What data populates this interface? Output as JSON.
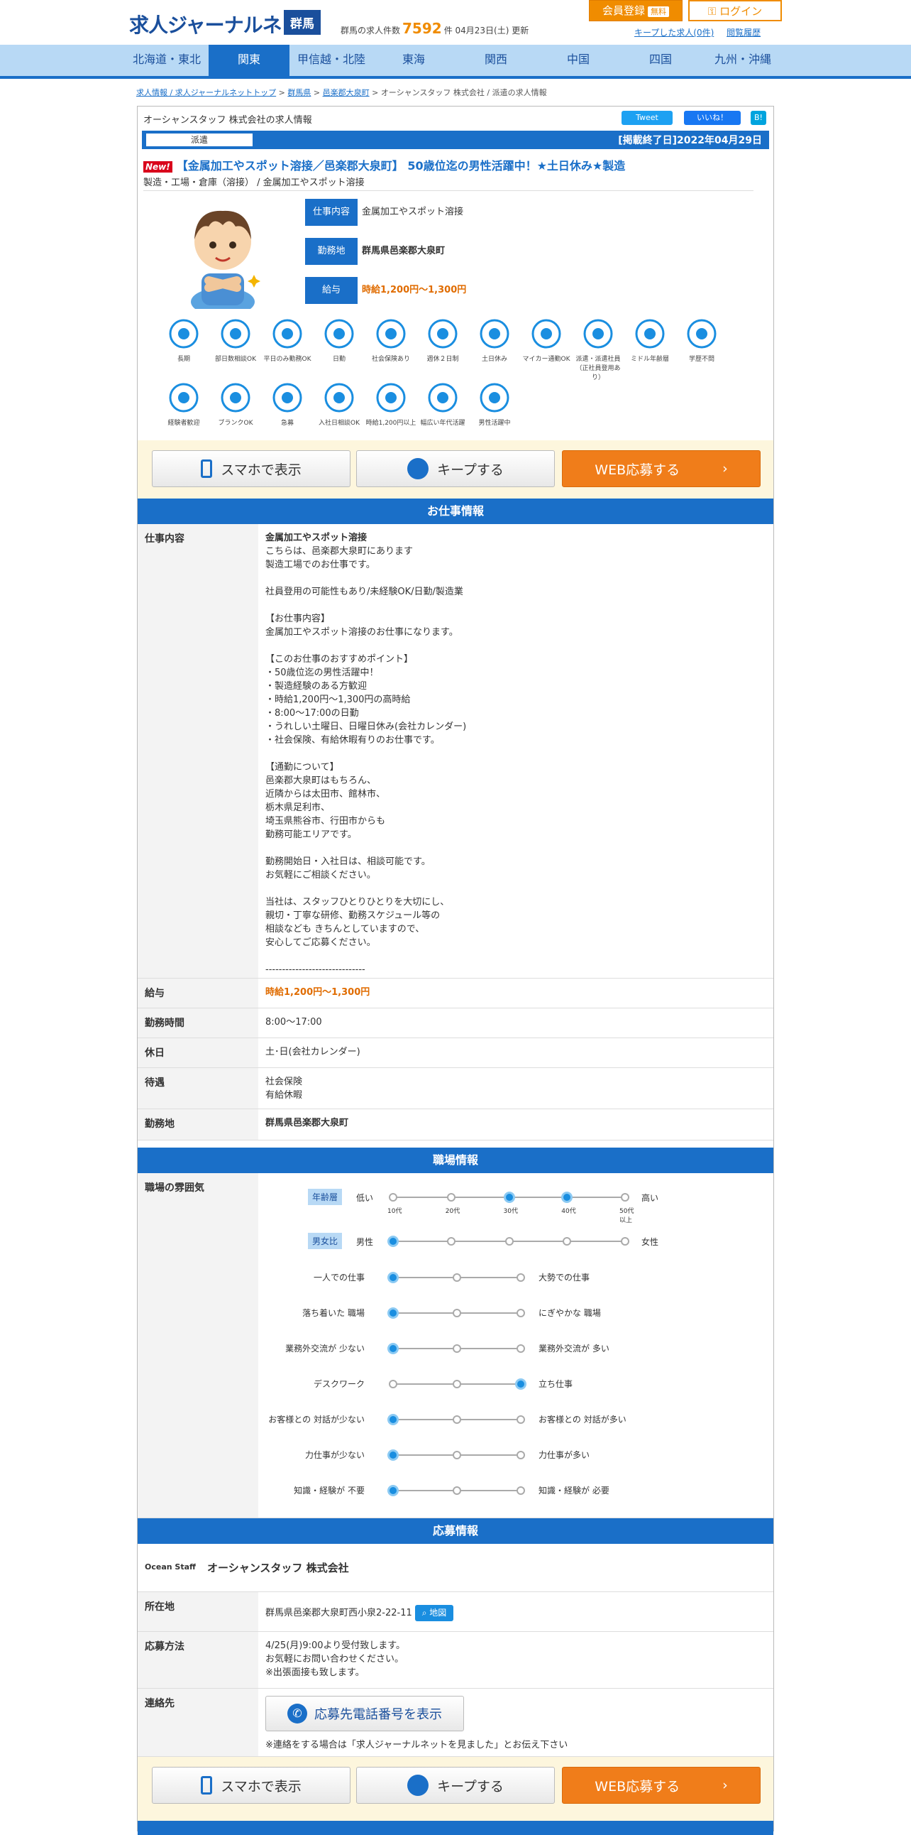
{
  "header": {
    "logo": "求人ジャーナルネット",
    "pref": "群馬",
    "count_pre": "群馬の求人件数",
    "count": "7592",
    "count_post": "件 04月23日(土) 更新",
    "register": "会員登録",
    "free": "無料",
    "login": "ログイン",
    "kept": "キープした求人(0件)",
    "history": "閲覧履歴"
  },
  "nav": [
    "北海道・東北",
    "関東",
    "甲信越・北陸",
    "東海",
    "関西",
    "中国",
    "四国",
    "九州・沖縄"
  ],
  "breadcrumb": {
    "b1": "求人情報 / 求人ジャーナルネットトップ",
    "b2": "群馬県",
    "b3": "邑楽郡大泉町",
    "b4": "オーシャンスタッフ 株式会社 / 派遣の求人情報"
  },
  "job": {
    "company_title": "オーシャンスタッフ 株式会社の求人情報",
    "tweet": "Tweet",
    "like": "いいね！",
    "hatena": "B!",
    "type": "派遣",
    "posted": "[掲載終了日]2022年04月29日",
    "new": "New!",
    "title": "【金属加工やスポット溶接／邑楽郡大泉町】 50歳位迄の男性活躍中！★土日休み★製造",
    "category": "製造・工場・倉庫（溶接） / 金属加工やスポット溶接",
    "summary": [
      {
        "label": "仕事内容",
        "value": "金属加工やスポット溶接"
      },
      {
        "label": "勤務地",
        "value": "群馬県邑楽郡大泉町"
      },
      {
        "label": "給与",
        "value": "時給1,200円～1,300円"
      }
    ]
  },
  "features": [
    "長期",
    "部日数相談OK",
    "平日のみ勤務OK",
    "日勤",
    "社会保険あり",
    "週休２日制",
    "土日休み",
    "マイカー通勤OK",
    "派遣・派遣社員（正社員登用あり）",
    "ミドル年齢層",
    "学歴不問",
    "経験者歓迎",
    "ブランクOK",
    "急募",
    "入社日相談OK",
    "時給1,200円以上",
    "幅広い年代活躍",
    "男性活躍中"
  ],
  "actions": {
    "phone": "スマホで表示",
    "keep": "キープする",
    "web": "WEB応募する"
  },
  "sections": {
    "work": "お仕事情報",
    "workplace": "職場情報",
    "apply": "応募情報"
  },
  "work_rows": [
    {
      "label": "仕事内容",
      "value_head": "金属加工やスポット溶接",
      "value": "こちらは、邑楽郡大泉町にあります\n製造工場でのお仕事です。\n\n社員登用の可能性もあり/未経験OK/日勤/製造業\n\n【お仕事内容】\n金属加工やスポット溶接のお仕事になります。\n\n【このお仕事のおすすめポイント】\n・50歳位迄の男性活躍中！\n・製造経験のある方歓迎\n・時給1,200円～1,300円の高時給\n・8:00～17:00の日勤\n・うれしい土曜日、日曜日休み(会社カレンダー)\n・社会保険、有給休暇有りのお仕事です。\n\n【通勤について】\n邑楽郡大泉町はもちろん、\n近隣からは太田市、館林市、\n栃木県足利市、\n埼玉県熊谷市、行田市からも\n勤務可能エリアです。\n\n勤務開始日・入社日は、相談可能です。\nお気軽にご相談ください。\n\n当社は、スタッフひとりひとりを大切にし、\n親切・丁寧な研修、勤務スケジュール等の\n相談なども きちんとしていますので、\n安心してご応募ください。\n\n------------------------------"
    },
    {
      "label": "給与",
      "value": "時給1,200円～1,300円"
    },
    {
      "label": "勤務時間",
      "value": "8:00～17:00"
    },
    {
      "label": "休日",
      "value": "土･日(会社カレンダー)"
    },
    {
      "label": "待遇",
      "value": "社会保険\n有給休暇"
    },
    {
      "label": "勤務地",
      "value": "群馬県邑楽郡大泉町"
    }
  ],
  "workplace": {
    "label": "職場の雰囲気",
    "age_badge": "年齢層",
    "age_low": "低い",
    "age_high": "高い",
    "ages": [
      "10代",
      "20代",
      "30代",
      "40代",
      "50代 以上"
    ],
    "gender_badge": "男女比",
    "male": "男性",
    "female": "女性",
    "scales": [
      {
        "left": "一人での仕事",
        "right": "大勢での仕事",
        "pos": 0
      },
      {
        "left": "落ち着いた 職場",
        "right": "にぎやかな 職場",
        "pos": 0
      },
      {
        "left": "業務外交流が 少ない",
        "right": "業務外交流が 多い",
        "pos": 0
      },
      {
        "left": "デスクワーク",
        "right": "立ち仕事",
        "pos": 2
      },
      {
        "left": "お客様との 対話が少ない",
        "right": "お客様との 対話が多い",
        "pos": 0
      },
      {
        "left": "力仕事が少ない",
        "right": "力仕事が多い",
        "pos": 0
      },
      {
        "left": "知識・経験が 不要",
        "right": "知識・経験が 必要",
        "pos": 0
      }
    ]
  },
  "apply": {
    "logo": "Ocean Staff",
    "company": "オーシャンスタッフ 株式会社",
    "addr_label": "所在地",
    "addr": "群馬県邑楽郡大泉町西小泉2-22-11",
    "map": "地図",
    "method_label": "応募方法",
    "method": "4/25(月)9:00より受付致します。\nお気軽にお問い合わせください。\n※出張面接も致します。",
    "contact_label": "連絡先",
    "tel_btn": "応募先電話番号を表示",
    "note": "※連絡をする場合は「求人ジャーナルネットを見ました」とお伝え下さい"
  }
}
